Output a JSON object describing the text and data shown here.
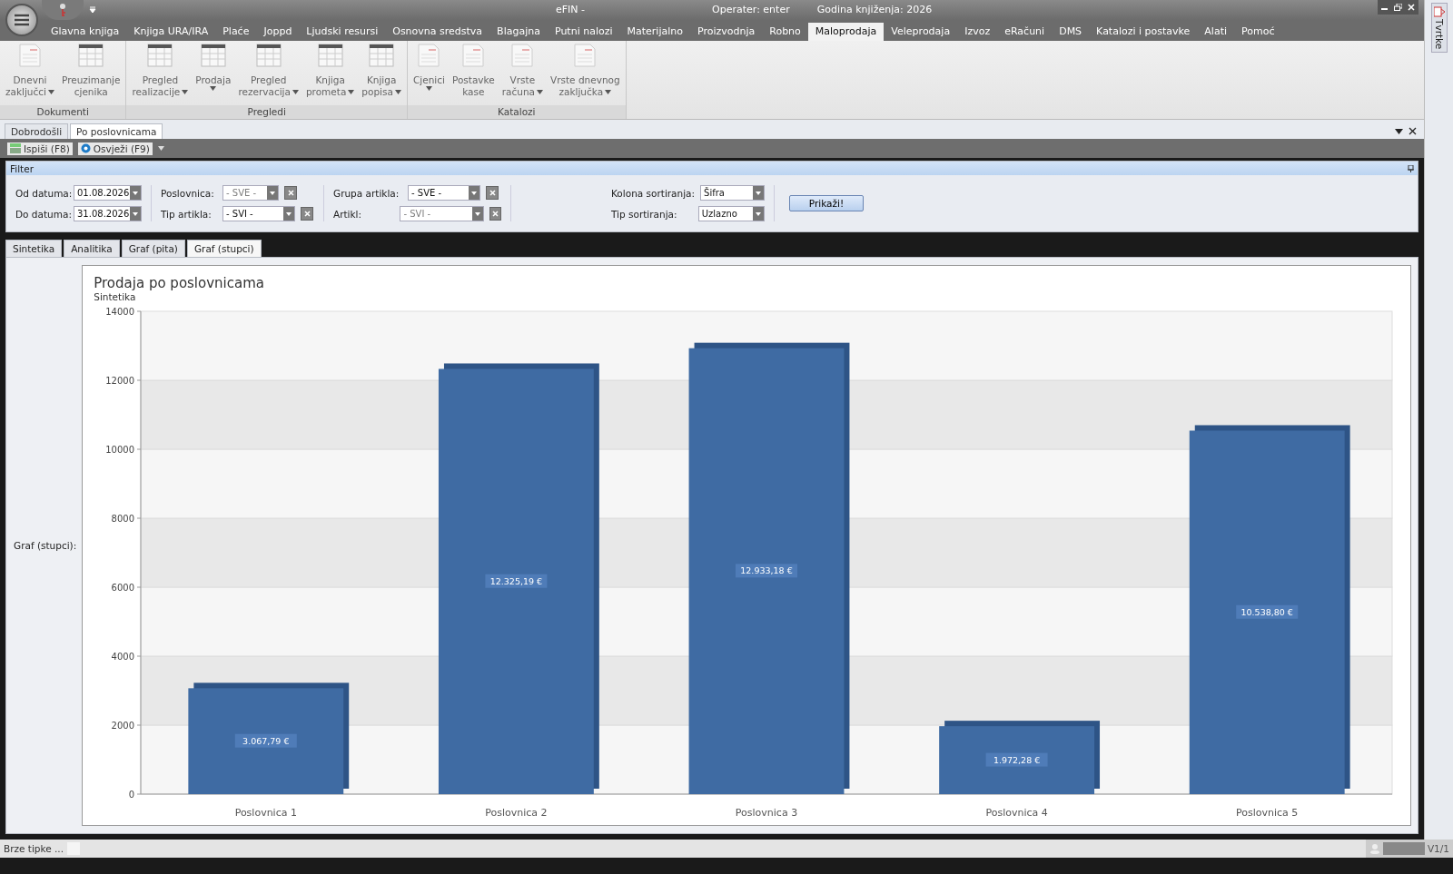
{
  "window": {
    "title": "eFIN -",
    "operator": "Operater: enter",
    "year": "Godina knjiženja: 2026"
  },
  "menu_tabs": [
    {
      "label": "Glavna knjiga",
      "selected": false
    },
    {
      "label": "Knjiga URA/IRA",
      "selected": false
    },
    {
      "label": "Plaće",
      "selected": false
    },
    {
      "label": "Joppd",
      "selected": false
    },
    {
      "label": "Ljudski resursi",
      "selected": false
    },
    {
      "label": "Osnovna sredstva",
      "selected": false
    },
    {
      "label": "Blagajna",
      "selected": false
    },
    {
      "label": "Putni nalozi",
      "selected": false
    },
    {
      "label": "Materijalno",
      "selected": false
    },
    {
      "label": "Proizvodnja",
      "selected": false
    },
    {
      "label": "Robno",
      "selected": false
    },
    {
      "label": "Maloprodaja",
      "selected": true
    },
    {
      "label": "Veleprodaja",
      "selected": false
    },
    {
      "label": "Izvoz",
      "selected": false
    },
    {
      "label": "eRačuni",
      "selected": false
    },
    {
      "label": "DMS",
      "selected": false
    },
    {
      "label": "Katalozi i postavke",
      "selected": false
    },
    {
      "label": "Alati",
      "selected": false
    },
    {
      "label": "Pomoć",
      "selected": false
    }
  ],
  "ribbon_groups": [
    {
      "title": "Dokumenti",
      "buttons": [
        {
          "line1": "Dnevni",
          "line2": "zaključci",
          "dropdown": true,
          "kind": "doc"
        },
        {
          "line1": "Preuzimanje",
          "line2": "cjenika",
          "dropdown": false,
          "kind": "grid"
        }
      ]
    },
    {
      "title": "Pregledi",
      "buttons": [
        {
          "line1": "Pregled",
          "line2": "realizacije",
          "dropdown": true,
          "kind": "grid"
        },
        {
          "line1": "Prodaja",
          "dropdown": true,
          "kind": "grid"
        },
        {
          "line1": "Pregled",
          "line2": "rezervacija",
          "dropdown": true,
          "kind": "grid"
        },
        {
          "line1": "Knjiga",
          "line2": "prometa",
          "dropdown": true,
          "kind": "grid"
        },
        {
          "line1": "Knjiga",
          "line2": "popisa",
          "dropdown": true,
          "kind": "grid"
        }
      ]
    },
    {
      "title": "Katalozi",
      "buttons": [
        {
          "line1": "Cjenici",
          "dropdown": true,
          "kind": "doc"
        },
        {
          "line1": "Postavke",
          "line2": "kase",
          "dropdown": false,
          "kind": "doc"
        },
        {
          "line1": "Vrste",
          "line2": "računa",
          "dropdown": true,
          "kind": "doc"
        },
        {
          "line1": "Vrste dnevnog",
          "line2": "zaključka",
          "dropdown": true,
          "kind": "doc"
        }
      ]
    }
  ],
  "doc_tabs": [
    {
      "label": "Dobrodošli",
      "selected": false
    },
    {
      "label": "Po poslovnicama",
      "selected": true
    }
  ],
  "toolbar": [
    {
      "label": "Ispiši (F8)",
      "kind": "print"
    },
    {
      "label": "Osvježi (F9)",
      "kind": "refresh"
    }
  ],
  "filter": {
    "title": "Filter",
    "columns": [
      [
        {
          "label": "Od datuma:",
          "value": "01.08.2026",
          "disabled": false,
          "clear": false
        },
        {
          "label": "Do datuma:",
          "value": "31.08.2026",
          "disabled": false,
          "clear": false
        }
      ],
      [
        {
          "label": "Poslovnica:",
          "value": "- SVE -",
          "disabled": true,
          "clear": true
        },
        {
          "label": "Tip artikla:",
          "value": "- SVI -",
          "disabled": false,
          "clear": true
        }
      ],
      [
        {
          "label": "Grupa artikla:",
          "value": "- SVE -",
          "disabled": false,
          "clear": true
        },
        {
          "label": "Artikl:",
          "value": "- SVI -",
          "disabled": true,
          "clear": true
        }
      ],
      [
        {
          "label": "Kolona sortiranja:",
          "value": "Šifra",
          "disabled": false,
          "clear": false
        },
        {
          "label": "Tip sortiranja:",
          "value": "Uzlazno",
          "disabled": false,
          "clear": false
        }
      ]
    ],
    "button": "Prikaži!"
  },
  "view_tabs": [
    {
      "label": "Sintetika",
      "selected": false
    },
    {
      "label": "Analitika",
      "selected": false
    },
    {
      "label": "Graf (pita)",
      "selected": false
    },
    {
      "label": "Graf (stupci)",
      "selected": true
    }
  ],
  "chart_label": "Graf (stupci):",
  "chart_data": {
    "type": "bar",
    "title": "Prodaja po poslovnicama",
    "subtitle": "Sintetika",
    "categories": [
      "Poslovnica 1",
      "Poslovnica 2",
      "Poslovnica 3",
      "Poslovnica 4",
      "Poslovnica 5"
    ],
    "series": [
      {
        "color": "#3f6ba3",
        "values": [
          3070,
          12330,
          12930,
          1970,
          10540
        ]
      }
    ],
    "ylim": [
      0,
      14000
    ],
    "yticks": [
      0,
      2000,
      4000,
      6000,
      8000,
      10000,
      12000,
      14000
    ],
    "value_labels": [
      "3.067,79 €",
      "12.325,19 €",
      "12.933,18 €",
      "1.972,28 €",
      "10.538,80 €"
    ]
  },
  "side_tab": "Tvrtke",
  "status_bar": {
    "hint": "Brze tipke ...",
    "version": "V1/1"
  }
}
